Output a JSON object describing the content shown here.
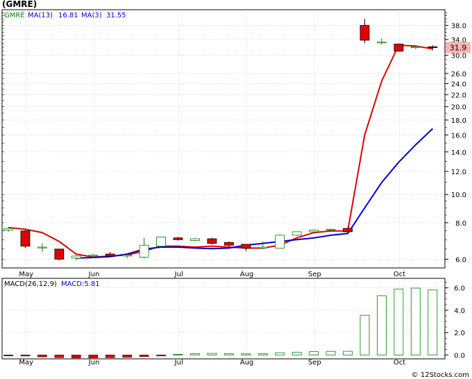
{
  "title": "(GMRE)",
  "legend": {
    "symbol": "GMRE",
    "ma13_label": "MA(13)",
    "ma13_value": "16.81",
    "ma3_label": "MA(3)",
    "ma3_value": "31.55"
  },
  "macd_legend": {
    "label": "MACD(26,12,9)",
    "value_label": "MACD:5.81"
  },
  "last_price_tag": "31.9",
  "watermark": "© 12Stocks.com",
  "colors": {
    "up": "#008000",
    "down": "#e00000",
    "ma13": "#0000cc",
    "ma3": "#e00000",
    "grid": "#b8b8b8",
    "tag_bg": "#ffb3b3"
  },
  "chart_data": [
    {
      "type": "candlestick",
      "scale": "log",
      "x_labels": [
        "May",
        "Jun",
        "Jul",
        "Aug",
        "Sep",
        "Oct"
      ],
      "y_ticks": [
        6.0,
        8.0,
        10.0,
        12.0,
        14.0,
        16.0,
        18.0,
        20.0,
        22.0,
        24.0,
        26.0,
        30.0,
        34.0,
        38.0
      ],
      "y_range": [
        5.6,
        43.0
      ],
      "candles": [
        {
          "o": 7.55,
          "h": 7.7,
          "l": 7.45,
          "c": 7.65
        },
        {
          "o": 7.5,
          "h": 7.55,
          "l": 6.55,
          "c": 6.65
        },
        {
          "o": 6.6,
          "h": 6.8,
          "l": 6.35,
          "c": 6.6
        },
        {
          "o": 6.5,
          "h": 6.5,
          "l": 5.95,
          "c": 6.0
        },
        {
          "o": 6.05,
          "h": 6.2,
          "l": 5.95,
          "c": 6.15
        },
        {
          "o": 6.15,
          "h": 6.25,
          "l": 6.05,
          "c": 6.2
        },
        {
          "o": 6.25,
          "h": 6.35,
          "l": 6.1,
          "c": 6.15
        },
        {
          "o": 6.15,
          "h": 6.25,
          "l": 6.05,
          "c": 6.2
        },
        {
          "o": 6.1,
          "h": 7.1,
          "l": 6.05,
          "c": 6.7
        },
        {
          "o": 6.65,
          "h": 7.15,
          "l": 6.6,
          "c": 7.15
        },
        {
          "o": 7.1,
          "h": 7.15,
          "l": 6.95,
          "c": 7.0
        },
        {
          "o": 6.95,
          "h": 7.1,
          "l": 6.9,
          "c": 7.05
        },
        {
          "o": 7.05,
          "h": 7.1,
          "l": 6.75,
          "c": 6.8
        },
        {
          "o": 6.85,
          "h": 6.9,
          "l": 6.6,
          "c": 6.7
        },
        {
          "o": 6.75,
          "h": 6.75,
          "l": 6.4,
          "c": 6.55
        },
        {
          "o": 6.55,
          "h": 6.9,
          "l": 6.5,
          "c": 6.6
        },
        {
          "o": 6.55,
          "h": 7.3,
          "l": 6.55,
          "c": 7.25
        },
        {
          "o": 7.25,
          "h": 7.45,
          "l": 7.2,
          "c": 7.45
        },
        {
          "o": 7.45,
          "h": 7.6,
          "l": 7.4,
          "c": 7.55
        },
        {
          "o": 7.55,
          "h": 7.65,
          "l": 7.5,
          "c": 7.6
        },
        {
          "o": 7.65,
          "h": 7.7,
          "l": 7.4,
          "c": 7.45
        },
        {
          "o": 38.0,
          "h": 40.0,
          "l": 33.0,
          "c": 33.8
        },
        {
          "o": 33.2,
          "h": 34.3,
          "l": 32.7,
          "c": 33.3
        },
        {
          "o": 32.8,
          "h": 32.9,
          "l": 30.9,
          "c": 31.0
        },
        {
          "o": 31.9,
          "h": 32.3,
          "l": 31.5,
          "c": 32.1
        },
        {
          "o": 32.1,
          "h": 32.5,
          "l": 31.2,
          "c": 31.9
        }
      ],
      "ma13": [
        null,
        null,
        null,
        null,
        6.05,
        6.08,
        6.12,
        6.25,
        6.5,
        6.6,
        6.6,
        6.55,
        6.52,
        6.55,
        6.7,
        6.8,
        6.9,
        7.0,
        7.1,
        7.25,
        7.35,
        9.0,
        11.0,
        12.9,
        14.8,
        16.81
      ],
      "ma3": [
        7.7,
        7.6,
        7.4,
        6.9,
        6.25,
        6.1,
        6.15,
        6.2,
        6.4,
        6.65,
        6.65,
        6.6,
        6.65,
        6.6,
        6.55,
        6.55,
        6.7,
        7.1,
        7.4,
        7.5,
        7.5,
        16.0,
        24.5,
        32.5,
        32.3,
        31.55
      ]
    },
    {
      "type": "bar",
      "label": "MACD(26,12,9)",
      "y_ticks": [
        0.0,
        2.0,
        4.0,
        6.0
      ],
      "y_range": [
        -0.35,
        6.85
      ],
      "values": [
        -0.08,
        -0.1,
        -0.17,
        -0.24,
        -0.27,
        -0.27,
        -0.25,
        -0.22,
        -0.15,
        -0.05,
        0.06,
        0.12,
        0.14,
        0.12,
        0.1,
        0.12,
        0.2,
        0.25,
        0.3,
        0.32,
        0.33,
        3.55,
        5.3,
        5.9,
        5.98,
        5.81
      ]
    }
  ]
}
